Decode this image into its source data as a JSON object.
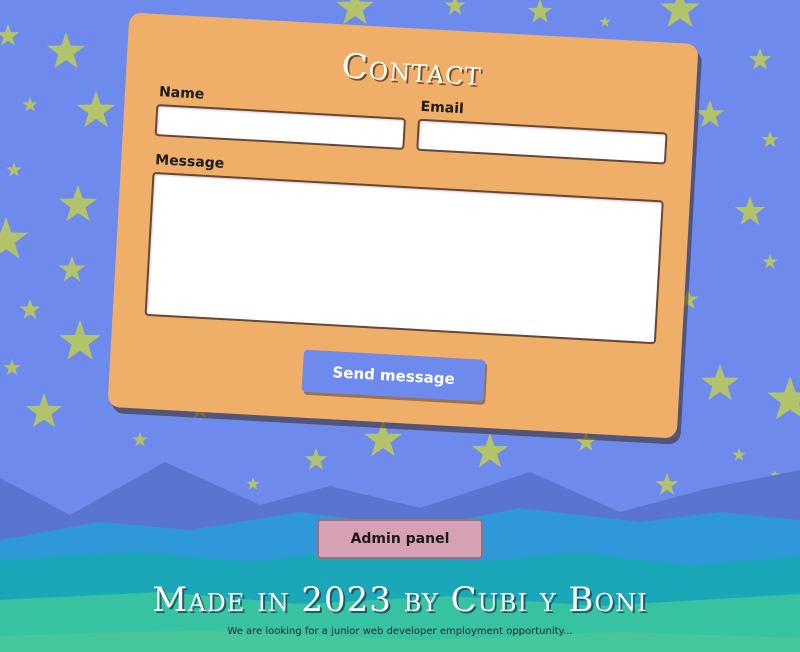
{
  "contact": {
    "title": "Contact",
    "name_label": "Name",
    "email_label": "Email",
    "message_label": "Message",
    "name_value": "",
    "email_value": "",
    "message_value": "",
    "send_label": "Send message"
  },
  "admin": {
    "button_label": "Admin panel"
  },
  "footer": {
    "title": "Made in 2023 by Cubi y Boni",
    "subtitle": "We are looking for a junior web developer employment opportunity..."
  },
  "colors": {
    "sky": "#6e8aec",
    "star": "#b3c36a",
    "card": "#efaf68",
    "button_primary": "#6e8aec",
    "button_admin": "#d6a1b3",
    "mountain_dark": "#5a74d2",
    "hill_teal": "#1aa8b8",
    "hill_green": "#37c2a2"
  },
  "icons": {
    "background_decoration": "star-icon"
  }
}
